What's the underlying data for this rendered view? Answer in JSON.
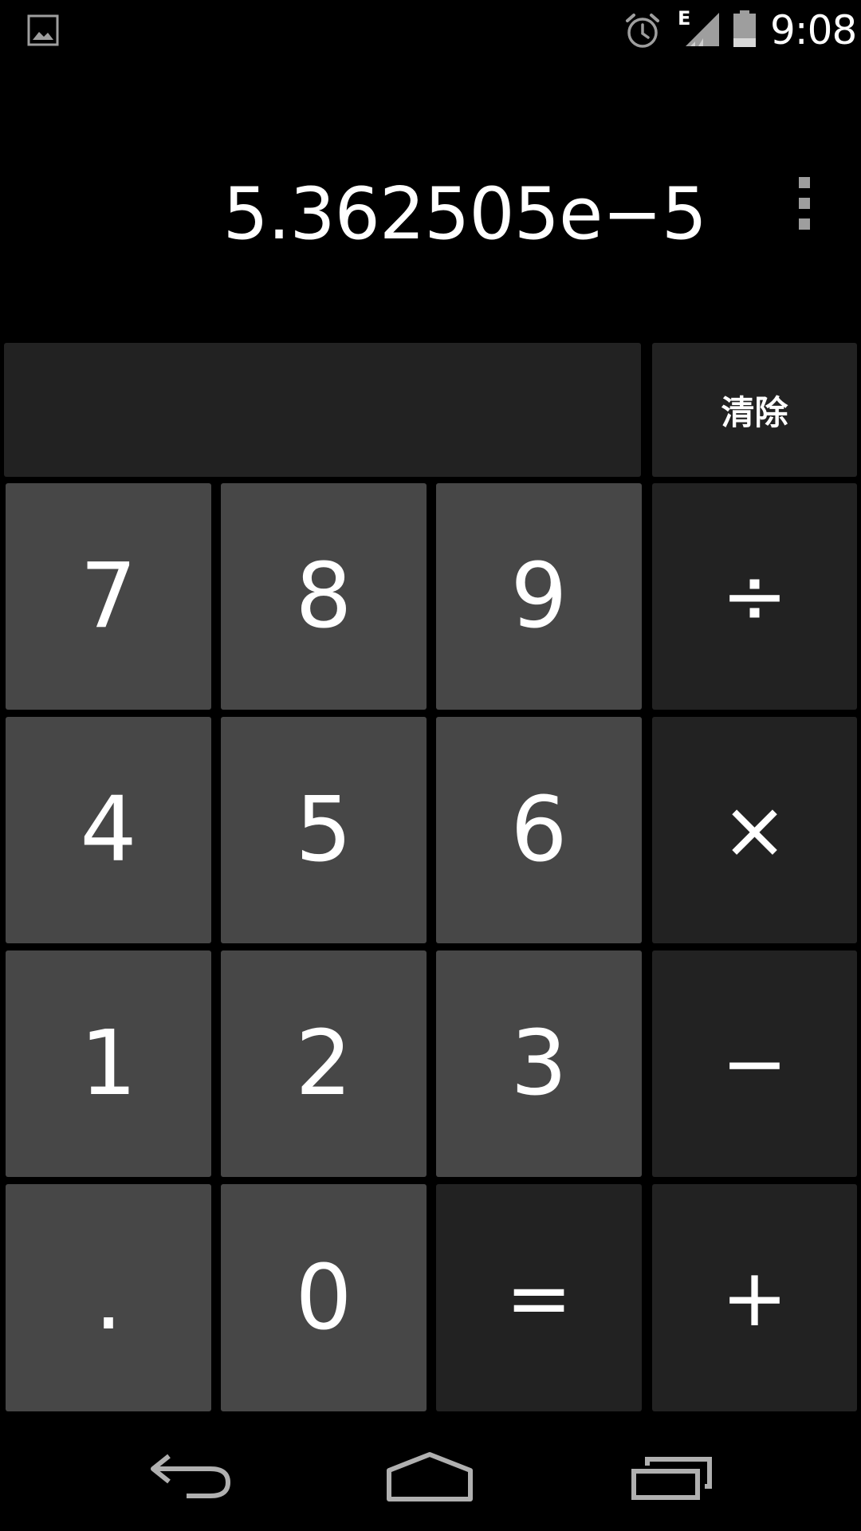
{
  "status_bar": {
    "network_type": "E",
    "time": "9:08"
  },
  "display": {
    "result": "5.362505e−5"
  },
  "keypad": {
    "clear_label": "清除",
    "keys": {
      "seven": "7",
      "eight": "8",
      "nine": "9",
      "divide": "÷",
      "four": "4",
      "five": "5",
      "six": "6",
      "multiply": "×",
      "one": "1",
      "two": "2",
      "three": "3",
      "minus": "−",
      "dot": ".",
      "zero": "0",
      "equals": "=",
      "plus": "+"
    }
  },
  "colors": {
    "background": "#000000",
    "number_key": "#474747",
    "operator_key": "#222222",
    "text": "#ffffff",
    "icon_gray": "#9e9e9e"
  },
  "icons": {
    "status": [
      "gallery-icon",
      "alarm-icon",
      "signal-icon",
      "battery-icon"
    ],
    "display": [
      "overflow-menu-icon"
    ],
    "nav": [
      "back-icon",
      "home-icon",
      "recents-icon"
    ]
  }
}
